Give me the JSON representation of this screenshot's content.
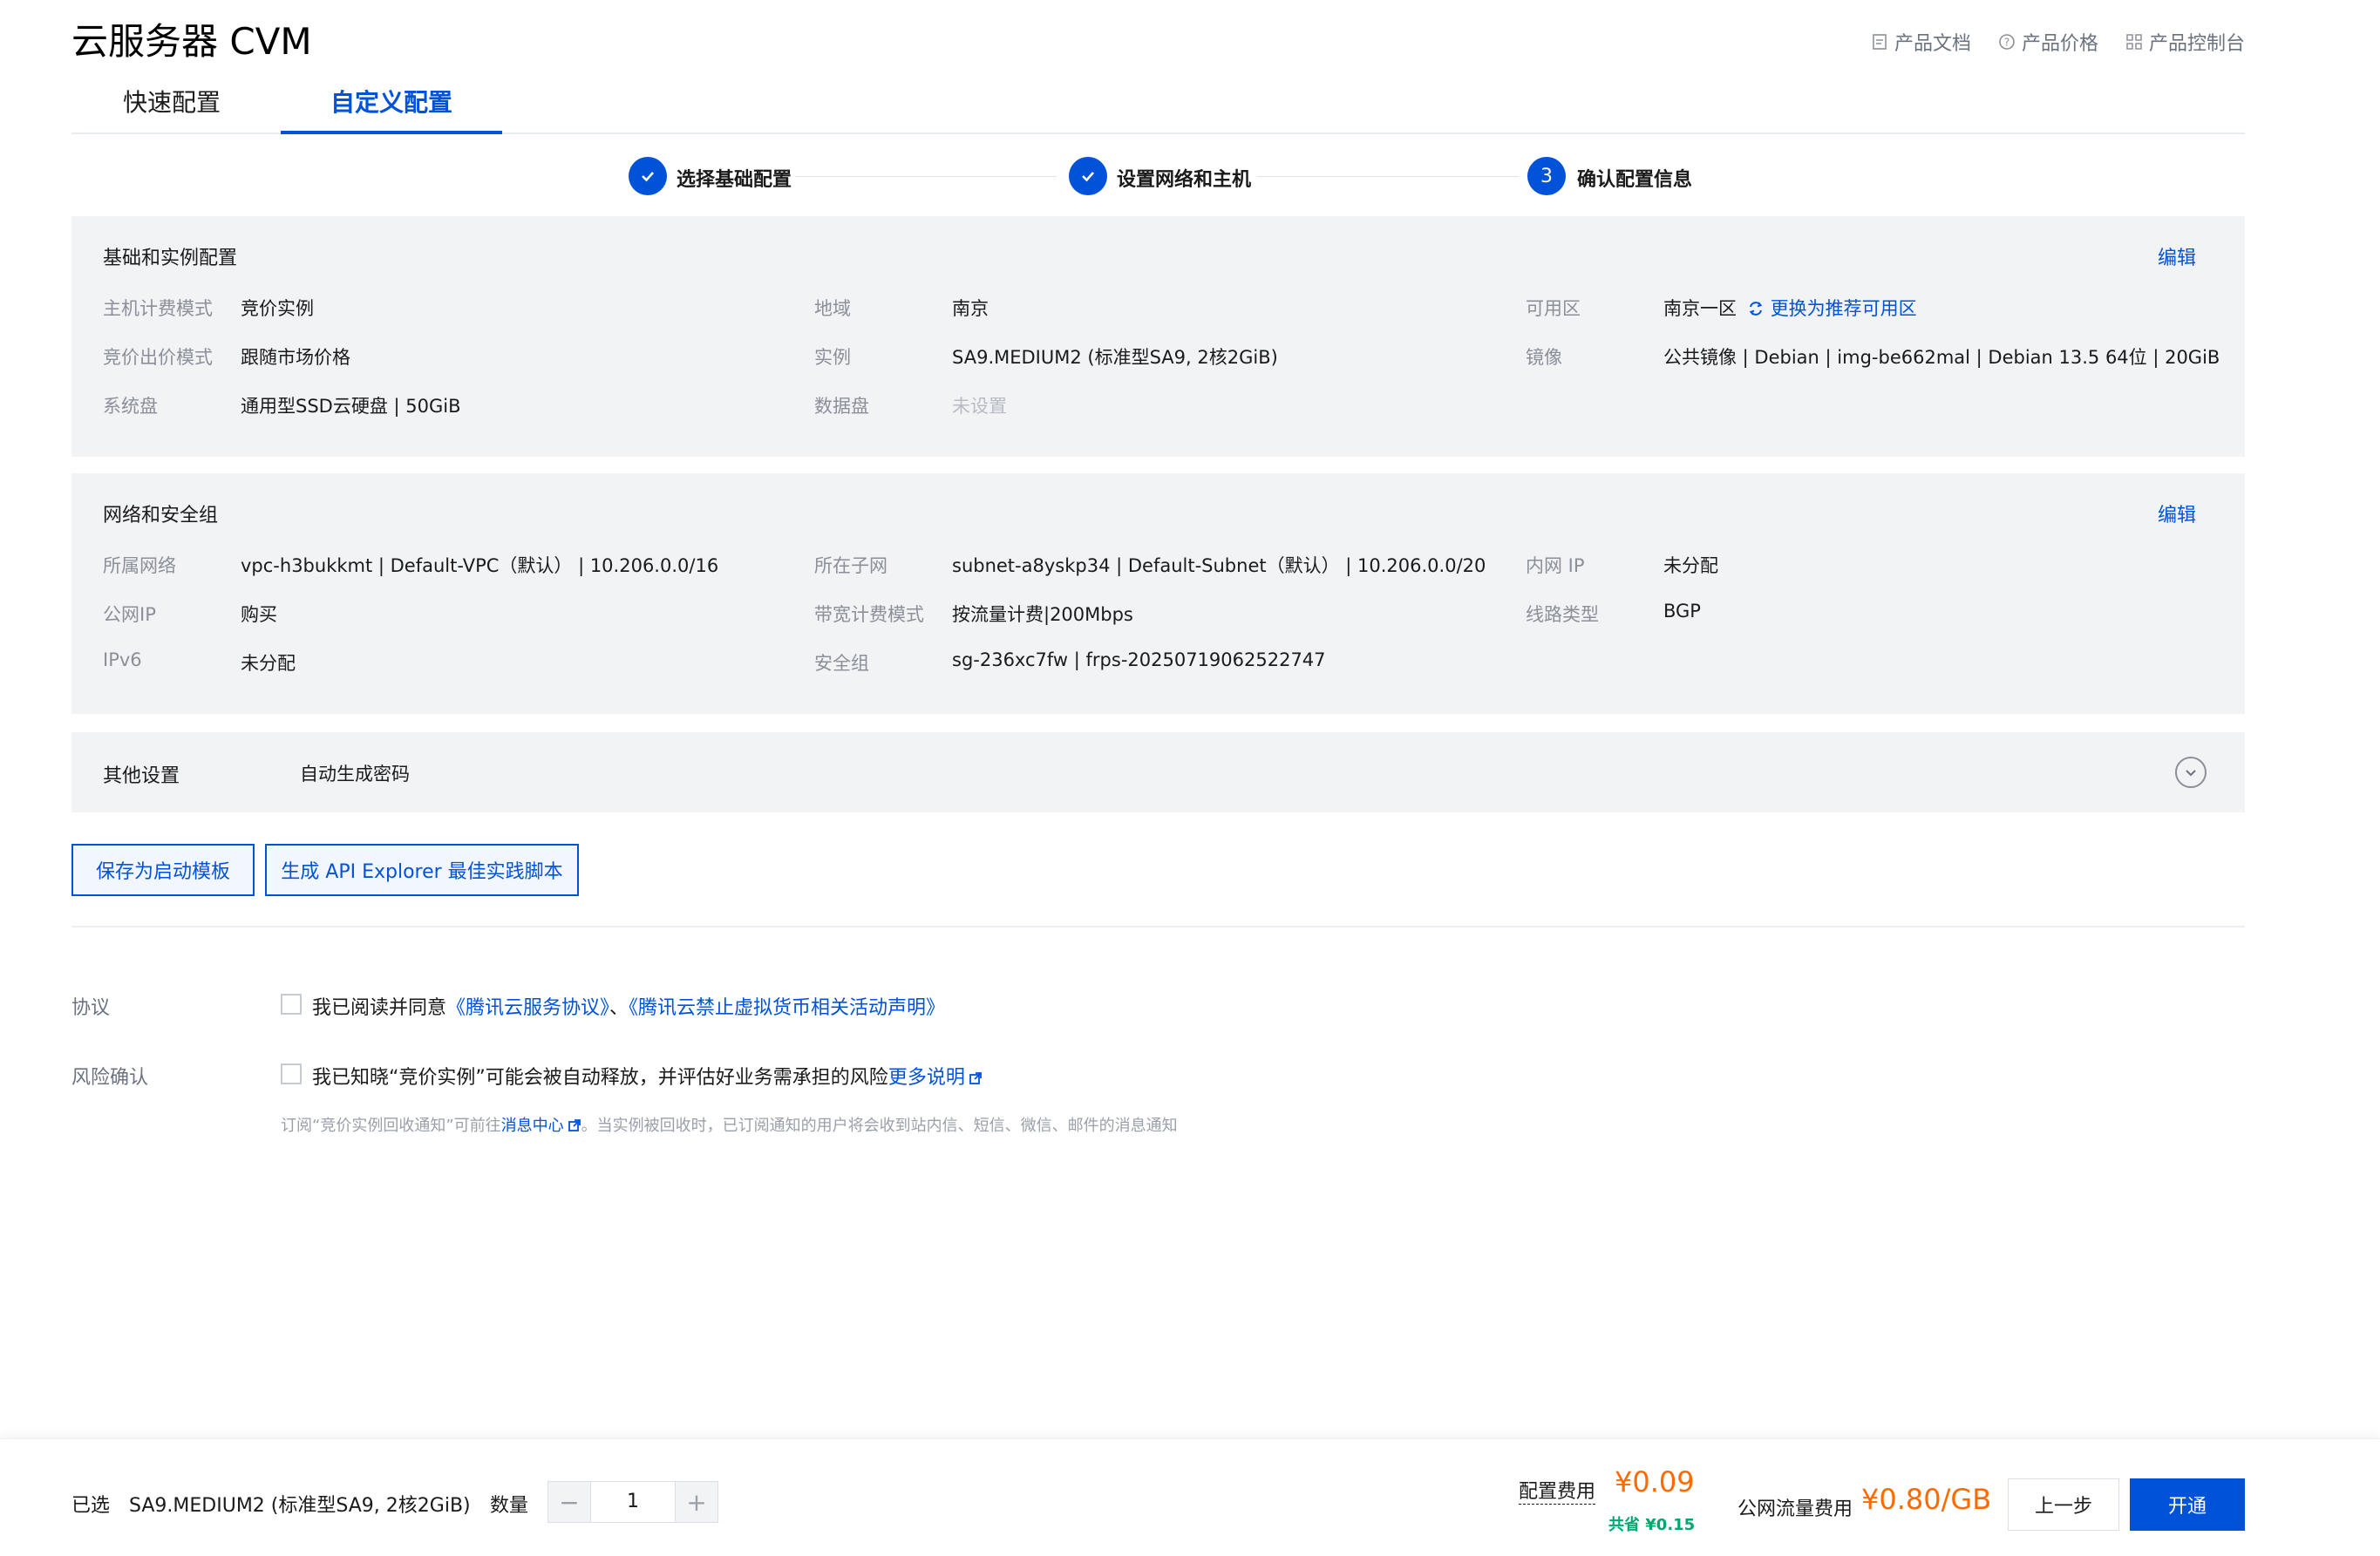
{
  "header": {
    "title": "云服务器 CVM",
    "links": {
      "docs": "产品文档",
      "price": "产品价格",
      "console": "产品控制台"
    }
  },
  "tabs": {
    "quick": "快速配置",
    "custom": "自定义配置"
  },
  "steps": [
    {
      "label": "选择基础配置",
      "state": "done"
    },
    {
      "label": "设置网络和主机",
      "state": "done"
    },
    {
      "label": "确认配置信息",
      "number": "3",
      "state": "active"
    }
  ],
  "basic": {
    "title": "基础和实例配置",
    "edit": "编辑",
    "billing_mode_label": "主机计费模式",
    "billing_mode": "竞价实例",
    "region_label": "地域",
    "region": "南京",
    "zone_label": "可用区",
    "zone": "南京一区",
    "zone_switch": "更换为推荐可用区",
    "bid_mode_label": "竞价出价模式",
    "bid_mode": "跟随市场价格",
    "instance_label": "实例",
    "instance": "SA9.MEDIUM2 (标准型SA9, 2核2GiB)",
    "image_label": "镜像",
    "image": "公共镜像 | Debian | img-be662mal | Debian 13.5 64位 | 20GiB",
    "system_disk_label": "系统盘",
    "system_disk": "通用型SSD云硬盘 | 50GiB",
    "data_disk_label": "数据盘",
    "data_disk": "未设置"
  },
  "network": {
    "title": "网络和安全组",
    "edit": "编辑",
    "vpc_label": "所属网络",
    "vpc": "vpc-h3bukkmt | Default-VPC（默认） | 10.206.0.0/16",
    "subnet_label": "所在子网",
    "subnet": "subnet-a8yskp34 | Default-Subnet（默认） | 10.206.0.0/20",
    "private_ip_label": "内网 IP",
    "private_ip": "未分配",
    "public_ip_label": "公网IP",
    "public_ip": "购买",
    "bandwidth_label": "带宽计费模式",
    "bandwidth": "按流量计费|200Mbps",
    "line_label": "线路类型",
    "line": "BGP",
    "ipv6_label": "IPv6",
    "ipv6": "未分配",
    "sg_label": "安全组",
    "sg": "sg-236xc7fw | frps-20250719062522747"
  },
  "other": {
    "title": "其他设置",
    "value": "自动生成密码"
  },
  "actions": {
    "save_template": "保存为启动模板",
    "gen_script": "生成 API Explorer 最佳实践脚本"
  },
  "agreement": {
    "label": "协议",
    "text": "我已阅读并同意",
    "link1": "《腾讯云服务协议》",
    "sep": "、",
    "link2": "《腾讯云禁止虚拟货币相关活动声明》"
  },
  "risk": {
    "label": "风险确认",
    "text": "我已知晓“竞价实例”可能会被自动释放，并评估好业务需承担的风险",
    "more": "更多说明",
    "hint_prefix": "订阅“竞价实例回收通知”可前往",
    "hint_link": "消息中心",
    "hint_suffix": "。当实例被回收时，已订阅通知的用户将会收到站内信、短信、微信、邮件的消息通知"
  },
  "footer": {
    "selected_label": "已选",
    "selected": "SA9.MEDIUM2 (标准型SA9, 2核2GiB)",
    "quantity_label": "数量",
    "quantity": "1",
    "config_fee_label": "配置费用",
    "config_fee": "¥0.09",
    "saving": "共省 ¥0.15",
    "traffic_fee_label": "公网流量费用",
    "traffic_fee": "¥0.80/GB",
    "prev": "上一步",
    "submit": "开通"
  },
  "colors": {
    "primary": "#0052d9",
    "price": "#ff6a00",
    "saving": "#00a870",
    "panel_bg": "#f2f3f5"
  }
}
